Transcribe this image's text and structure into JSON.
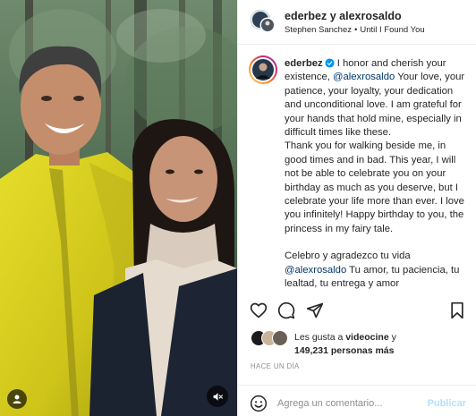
{
  "colors": {
    "link": "#00376b",
    "verified": "#0095f6",
    "post_disabled": "#b2dffc",
    "muted_text": "#8e8e8e",
    "jacket_yellow": "#d9d21e"
  },
  "media": {
    "avatar_button_icon": "user-icon",
    "mute_button_icon": "speaker-muted-icon"
  },
  "header": {
    "username": "ederbez y alexrosaldo",
    "audio_artist": "Stephen Sanchez",
    "audio_separator": "•",
    "audio_title": "Until I Found You"
  },
  "caption": {
    "username": "ederbez",
    "p1_before": "I honor and cherish your existence, ",
    "p1_mention": "@alexrosaldo",
    "p1_after": " Your love, your patience, your loyalty, your dedication and unconditional love. I am grateful for your hands that hold mine, especially in difficult times like these.",
    "p2": "Thank you for walking beside me, in good times and in bad. This year, I will not be able to celebrate you on your birthday as much as you deserve, but I celebrate your life more than ever. I love you infinitely! Happy birthday to you, the princess in my fairy tale.",
    "p3_before": "Celebro y agradezco tu vida ",
    "p3_mention": "@alexrosaldo",
    "p3_after": " Tu amor, tu paciencia, tu lealtad, tu entrega y amor"
  },
  "actions": {
    "like_icon": "heart-icon",
    "comment_icon": "comment-icon",
    "share_icon": "paper-plane-icon",
    "save_icon": "bookmark-icon"
  },
  "likes": {
    "prefix": "Les gusta a ",
    "account": "videocine",
    "suffix": " y",
    "count_text": "149,231 personas más"
  },
  "time_ago": "HACE UN DÍA",
  "comment": {
    "placeholder": "Agrega un comentario...",
    "post_label": "Publicar"
  }
}
